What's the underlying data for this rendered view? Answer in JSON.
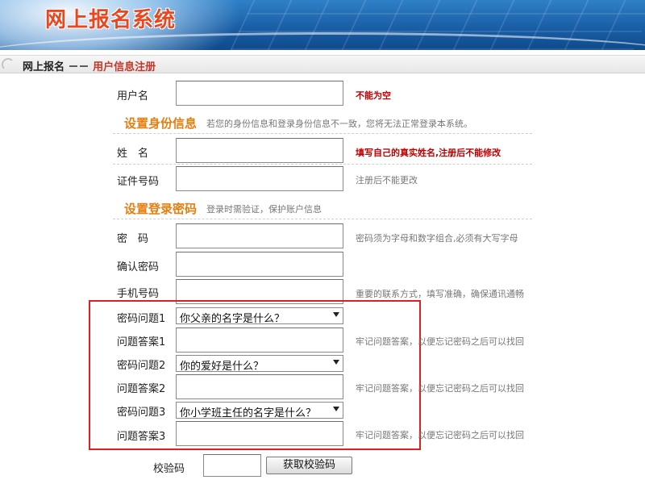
{
  "header": {
    "title": "网上报名系统"
  },
  "breadcrumb": {
    "home": "网上报名",
    "separator": "－－",
    "current": "用户信息注册"
  },
  "form": {
    "username": {
      "label": "用户名",
      "hint": "不能为空"
    },
    "identity_section": {
      "title": "设置身份信息",
      "desc": "若您的身份信息和登录身份信息不一致，您将无法正常登录本系统。"
    },
    "name": {
      "label": "姓　名",
      "hint": "填写自己的真实姓名,注册后不能修改"
    },
    "id_number": {
      "label": "证件号码",
      "hint": "注册后不能更改"
    },
    "password_section": {
      "title": "设置登录密码",
      "desc": "登录时需验证，保护账户信息"
    },
    "password": {
      "label": "密　码",
      "hint": "密码须为字母和数字组合,必须有大写字母"
    },
    "confirm_password": {
      "label": "确认密码"
    },
    "phone": {
      "label": "手机号码",
      "hint": "重要的联系方式，填写准确，确保通讯通畅"
    },
    "question1": {
      "label": "密码问题1",
      "value": "你父亲的名字是什么？"
    },
    "answer1": {
      "label": "问题答案1",
      "hint": "牢记问题答案，以便忘记密码之后可以找回"
    },
    "question2": {
      "label": "密码问题2",
      "value": "你的爱好是什么？"
    },
    "answer2": {
      "label": "问题答案2",
      "hint": "牢记问题答案，以便忘记密码之后可以找回"
    },
    "question3": {
      "label": "密码问题3",
      "value": "你小学班主任的名字是什么？"
    },
    "answer3": {
      "label": "问题答案3",
      "hint": "牢记问题答案，以便忘记密码之后可以找回"
    },
    "captcha": {
      "label": "校验码",
      "button": "获取校验码"
    }
  },
  "colors": {
    "accent": "#e67e10",
    "error": "#c00000",
    "highlight_box": "#e02020",
    "banner": "#1a5fa6"
  }
}
